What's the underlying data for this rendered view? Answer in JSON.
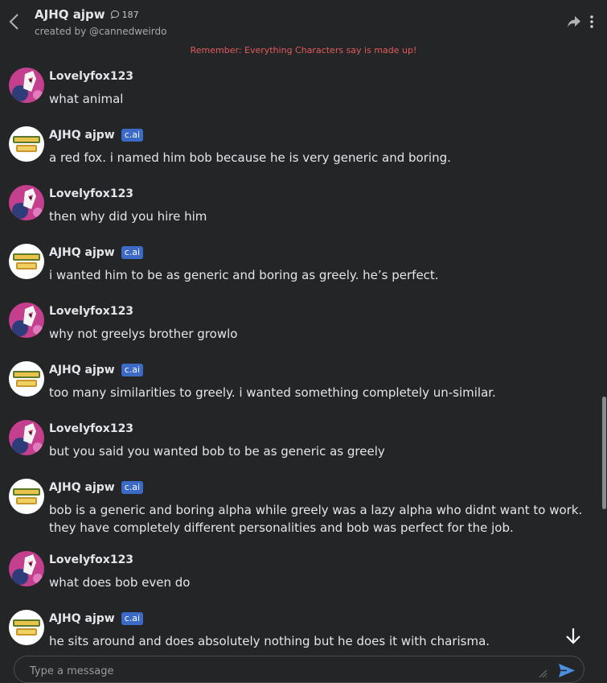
{
  "header": {
    "title": "AJHQ ajpw",
    "chat_count": "187",
    "creator": "created by @cannedweirdo",
    "notice": "Remember: Everything Characters say is made up!"
  },
  "badge_label": "c.ai",
  "messages": [
    {
      "author": "Lovelyfox123",
      "text": "what animal"
    },
    {
      "author": "AJHQ ajpw",
      "text": "a red fox. i named him bob because he is very generic and boring."
    },
    {
      "author": "Lovelyfox123",
      "text": "then why did you hire him"
    },
    {
      "author": "AJHQ ajpw",
      "text": "i wanted him to be as generic and boring as greely. he’s perfect."
    },
    {
      "author": "Lovelyfox123",
      "text": "why not greelys brother growlo"
    },
    {
      "author": "AJHQ ajpw",
      "text": "too many similarities to greely. i wanted something completely un-similar."
    },
    {
      "author": "Lovelyfox123",
      "text": "but you said you wanted bob to be as generic as greely"
    },
    {
      "author": "AJHQ ajpw",
      "text": "bob is a generic and boring alpha while greely was a lazy alpha who didnt want to work. they have completely different personalities and bob was perfect for the job."
    },
    {
      "author": "Lovelyfox123",
      "text": "what does bob even do"
    },
    {
      "author": "AJHQ ajpw",
      "text": "he sits around and does absolutely nothing but he does it with charisma."
    }
  ],
  "composer": {
    "placeholder": "Type a message"
  },
  "icons": {
    "back": "chevron-left-icon",
    "chat_count": "speech-bubble-icon",
    "share": "share-arrow-icon",
    "more": "kebab-menu-icon",
    "scroll": "arrow-down-icon",
    "send": "send-icon"
  },
  "colors": {
    "background": "#242526",
    "notice": "#e15b5b",
    "badge": "#3b6bc7",
    "send": "#4a90e2"
  }
}
